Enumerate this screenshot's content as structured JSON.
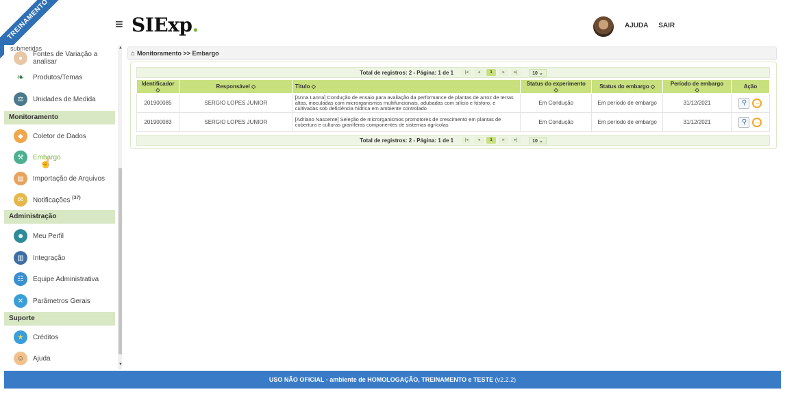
{
  "header": {
    "ribbon": "TREINAMENTO",
    "logo_text": "SIExp",
    "logo_dot": ".",
    "links": [
      "AJUDA",
      "SAIR"
    ],
    "colors": {
      "ribbon": "#2f6fb6",
      "accent": "#7cb342"
    }
  },
  "sidebar": {
    "cut_label": "submetidas",
    "items_top": [
      {
        "label": "Fontes de Variação a analisar",
        "icon": "avatar-icon"
      },
      {
        "label": "Produtos/Temas",
        "icon": "leaf-icon"
      },
      {
        "label": "Unidades de Medida",
        "icon": "ruler-icon"
      }
    ],
    "section_monitoramento": "Monitoramento",
    "items_monitoramento": [
      {
        "label": "Coletor de Dados",
        "icon": "android-icon"
      },
      {
        "label": "Embargo",
        "icon": "gavel-icon"
      },
      {
        "label": "Importação de Arquivos",
        "icon": "file-icon"
      },
      {
        "label": "Notificações",
        "badge": "(37)",
        "icon": "bell-icon"
      }
    ],
    "section_administracao": "Administração",
    "items_administracao": [
      {
        "label": "Meu Perfil",
        "icon": "user-icon"
      },
      {
        "label": "Integração",
        "icon": "building-icon"
      },
      {
        "label": "Equipe Administrativa",
        "icon": "team-icon"
      },
      {
        "label": "Parâmetros Gerais",
        "icon": "tools-icon"
      }
    ],
    "section_suporte": "Suporte",
    "items_suporte": [
      {
        "label": "Créditos",
        "icon": "star-icon"
      },
      {
        "label": "Ajuda",
        "icon": "help-icon"
      }
    ]
  },
  "breadcrumb": "Monitoramento >> Embargo",
  "pager": {
    "summary": "Total de registros: 2 - Página: 1 de 1",
    "current_page": "1",
    "page_size": "10"
  },
  "table": {
    "headers": [
      "Identificador",
      "Responsável",
      "Título",
      "Status do experimento",
      "Status do embargo",
      "Período de embargo",
      "Ação"
    ],
    "rows": [
      {
        "id": "201900085",
        "responsavel": "SERGIO LOPES JUNIOR",
        "titulo": "[Anna Lanna] Condução de ensaio para avaliação da performance de plantas de arroz de terras altas, inoculadas com microrganismos multifuncionais, adubadas com silício e fósforo, e cultivadas sob deficiência hídrica em ambiente controlado",
        "status_exp": "Em Condução",
        "status_emb": "Em período de embargo",
        "periodo": "31/12/2021"
      },
      {
        "id": "201900083",
        "responsavel": "SERGIO LOPES JUNIOR",
        "titulo": "[Adriano Nascente] Seleção de microrganismos promotores de crescimento em plantas de cobertura e culturas graníferas componentes de sistemas agrícolas",
        "status_exp": "Em Condução",
        "status_emb": "Em período de embargo",
        "periodo": "31/12/2021"
      }
    ]
  },
  "footer": {
    "text": "USO NÃO OFICIAL - ambiente de HOMOLOGAÇÃO, TREINAMENTO e TESTE",
    "version": "(v2.2.2)",
    "color": "#3a7bc8"
  }
}
